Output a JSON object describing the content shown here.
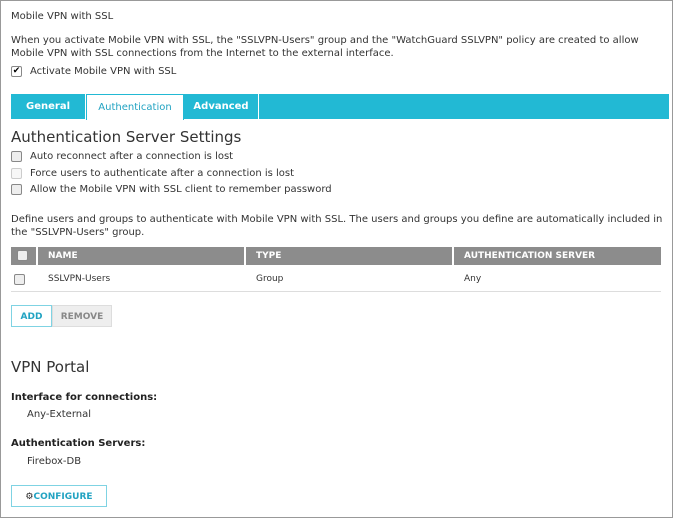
{
  "title": "Mobile VPN with SSL",
  "description": "When you activate Mobile VPN with SSL, the \"SSLVPN-Users\" group and the \"WatchGuard SSLVPN\" policy are created to allow Mobile VPN with SSL connections from the Internet to the external interface.",
  "activate_label": "Activate Mobile VPN with SSL",
  "tabs": [
    "General",
    "Authentication",
    "Advanced"
  ],
  "auth_heading": "Authentication Server Settings",
  "options": [
    "Auto reconnect after a connection is lost",
    "Force users to authenticate after a connection is lost",
    "Allow the Mobile VPN with SSL client to remember password"
  ],
  "define_text": "Define users and groups to authenticate with Mobile VPN with SSL. The users and groups you define are automatically included in the \"SSLVPN-Users\" group.",
  "table": {
    "headers": [
      "NAME",
      "TYPE",
      "AUTHENTICATION SERVER"
    ],
    "rows": [
      [
        "SSLVPN-Users",
        "Group",
        "Any"
      ]
    ]
  },
  "add_label": "ADD",
  "remove_label": "REMOVE",
  "portal": {
    "heading": "VPN Portal",
    "interface_label": "Interface for connections:",
    "interface_value": "Any-External",
    "servers_label": "Authentication Servers:",
    "servers_value": "Firebox-DB",
    "configure_label": "CONFIGURE"
  }
}
